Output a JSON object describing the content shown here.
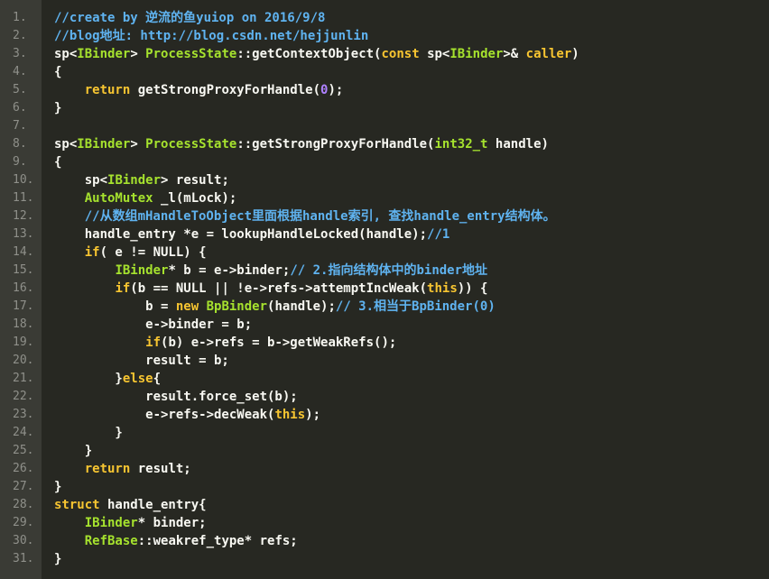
{
  "editor": {
    "colors": {
      "background": "#272822",
      "gutter": "#3a3b35",
      "line_number": "#8f908a",
      "text": "#f8f8f2",
      "comment": "#5fb3f0",
      "keyword": "#f7c531",
      "type": "#a6e22e",
      "number": "#ae81ff"
    },
    "lines": [
      {
        "n": "1.",
        "tokens": [
          {
            "t": "comment",
            "s": "//create by 逆流的鱼yuiop on 2016/9/8"
          }
        ]
      },
      {
        "n": "2.",
        "tokens": [
          {
            "t": "comment",
            "s": "//blog地址: http://blog.csdn.net/hejjunlin"
          }
        ]
      },
      {
        "n": "3.",
        "tokens": [
          {
            "t": "text",
            "s": "sp<"
          },
          {
            "t": "type",
            "s": "IBinder"
          },
          {
            "t": "text",
            "s": "> "
          },
          {
            "t": "type",
            "s": "ProcessState"
          },
          {
            "t": "text",
            "s": "::getContextObject("
          },
          {
            "t": "kw",
            "s": "const"
          },
          {
            "t": "text",
            "s": " sp<"
          },
          {
            "t": "type",
            "s": "IBinder"
          },
          {
            "t": "text",
            "s": ">& "
          },
          {
            "t": "kw",
            "s": "caller"
          },
          {
            "t": "text",
            "s": ")"
          }
        ]
      },
      {
        "n": "4.",
        "tokens": [
          {
            "t": "text",
            "s": "{"
          }
        ]
      },
      {
        "n": "5.",
        "tokens": [
          {
            "t": "text",
            "s": "    "
          },
          {
            "t": "kw",
            "s": "return"
          },
          {
            "t": "text",
            "s": " getStrongProxyForHandle("
          },
          {
            "t": "num",
            "s": "0"
          },
          {
            "t": "text",
            "s": ");"
          }
        ]
      },
      {
        "n": "6.",
        "tokens": [
          {
            "t": "text",
            "s": "}"
          }
        ]
      },
      {
        "n": "7.",
        "tokens": []
      },
      {
        "n": "8.",
        "tokens": [
          {
            "t": "text",
            "s": "sp<"
          },
          {
            "t": "type",
            "s": "IBinder"
          },
          {
            "t": "text",
            "s": "> "
          },
          {
            "t": "type",
            "s": "ProcessState"
          },
          {
            "t": "text",
            "s": "::getStrongProxyForHandle("
          },
          {
            "t": "type",
            "s": "int32_t"
          },
          {
            "t": "text",
            "s": " handle)"
          }
        ]
      },
      {
        "n": "9.",
        "tokens": [
          {
            "t": "text",
            "s": "{"
          }
        ]
      },
      {
        "n": "10.",
        "tokens": [
          {
            "t": "text",
            "s": "    sp<"
          },
          {
            "t": "type",
            "s": "IBinder"
          },
          {
            "t": "text",
            "s": "> result;"
          }
        ]
      },
      {
        "n": "11.",
        "tokens": [
          {
            "t": "text",
            "s": "    "
          },
          {
            "t": "type",
            "s": "AutoMutex"
          },
          {
            "t": "text",
            "s": " _l(mLock);"
          }
        ]
      },
      {
        "n": "12.",
        "tokens": [
          {
            "t": "text",
            "s": "    "
          },
          {
            "t": "comment",
            "s": "//从数组mHandleToObject里面根据handle索引, 查找handle_entry结构体。"
          }
        ]
      },
      {
        "n": "13.",
        "tokens": [
          {
            "t": "text",
            "s": "    handle_entry *e = lookupHandleLocked(handle);"
          },
          {
            "t": "comment",
            "s": "//1"
          }
        ]
      },
      {
        "n": "14.",
        "tokens": [
          {
            "t": "text",
            "s": "    "
          },
          {
            "t": "kw",
            "s": "if"
          },
          {
            "t": "text",
            "s": "( e != NULL) {"
          }
        ]
      },
      {
        "n": "15.",
        "tokens": [
          {
            "t": "text",
            "s": "        "
          },
          {
            "t": "type",
            "s": "IBinder"
          },
          {
            "t": "text",
            "s": "* b = e->binder;"
          },
          {
            "t": "comment",
            "s": "// 2.指向结构体中的binder地址"
          }
        ]
      },
      {
        "n": "16.",
        "tokens": [
          {
            "t": "text",
            "s": "        "
          },
          {
            "t": "kw",
            "s": "if"
          },
          {
            "t": "text",
            "s": "(b == NULL || !e->refs->attemptIncWeak("
          },
          {
            "t": "kw",
            "s": "this"
          },
          {
            "t": "text",
            "s": ")) {"
          }
        ]
      },
      {
        "n": "17.",
        "tokens": [
          {
            "t": "text",
            "s": "            b = "
          },
          {
            "t": "kw",
            "s": "new"
          },
          {
            "t": "text",
            "s": " "
          },
          {
            "t": "type",
            "s": "BpBinder"
          },
          {
            "t": "text",
            "s": "(handle);"
          },
          {
            "t": "comment",
            "s": "// 3.相当于BpBinder(0)"
          }
        ]
      },
      {
        "n": "18.",
        "tokens": [
          {
            "t": "text",
            "s": "            e->binder = b;"
          }
        ]
      },
      {
        "n": "19.",
        "tokens": [
          {
            "t": "text",
            "s": "            "
          },
          {
            "t": "kw",
            "s": "if"
          },
          {
            "t": "text",
            "s": "(b) e->refs = b->getWeakRefs();"
          }
        ]
      },
      {
        "n": "20.",
        "tokens": [
          {
            "t": "text",
            "s": "            result = b;"
          }
        ]
      },
      {
        "n": "21.",
        "tokens": [
          {
            "t": "text",
            "s": "        }"
          },
          {
            "t": "kw",
            "s": "else"
          },
          {
            "t": "text",
            "s": "{"
          }
        ]
      },
      {
        "n": "22.",
        "tokens": [
          {
            "t": "text",
            "s": "            result.force_set(b);"
          }
        ]
      },
      {
        "n": "23.",
        "tokens": [
          {
            "t": "text",
            "s": "            e->refs->decWeak("
          },
          {
            "t": "kw",
            "s": "this"
          },
          {
            "t": "text",
            "s": ");"
          }
        ]
      },
      {
        "n": "24.",
        "tokens": [
          {
            "t": "text",
            "s": "        }"
          }
        ]
      },
      {
        "n": "25.",
        "tokens": [
          {
            "t": "text",
            "s": "    }"
          }
        ]
      },
      {
        "n": "26.",
        "tokens": [
          {
            "t": "text",
            "s": "    "
          },
          {
            "t": "kw",
            "s": "return"
          },
          {
            "t": "text",
            "s": " result;"
          }
        ]
      },
      {
        "n": "27.",
        "tokens": [
          {
            "t": "text",
            "s": "}"
          }
        ]
      },
      {
        "n": "28.",
        "tokens": [
          {
            "t": "kw",
            "s": "struct"
          },
          {
            "t": "text",
            "s": " handle_entry{"
          }
        ]
      },
      {
        "n": "29.",
        "tokens": [
          {
            "t": "text",
            "s": "    "
          },
          {
            "t": "type",
            "s": "IBinder"
          },
          {
            "t": "text",
            "s": "* binder;"
          }
        ]
      },
      {
        "n": "30.",
        "tokens": [
          {
            "t": "text",
            "s": "    "
          },
          {
            "t": "type",
            "s": "RefBase"
          },
          {
            "t": "text",
            "s": "::weakref_type* refs;"
          }
        ]
      },
      {
        "n": "31.",
        "tokens": [
          {
            "t": "text",
            "s": "}"
          }
        ]
      }
    ]
  }
}
